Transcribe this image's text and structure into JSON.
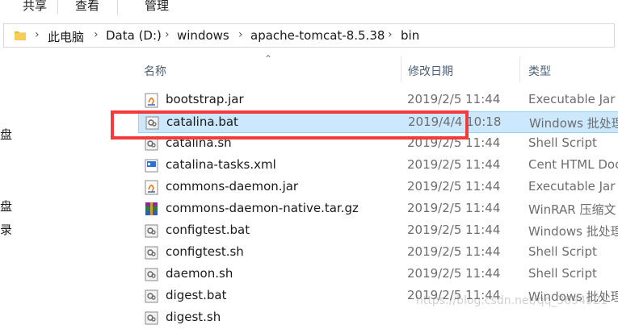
{
  "ribbon": {
    "tabs": [
      "共享",
      "查看",
      "管理"
    ]
  },
  "address_bar": {
    "breadcrumbs": [
      "此电脑",
      "Data (D:)",
      "windows",
      "apache-tomcat-8.5.38",
      "bin"
    ]
  },
  "nav_pane": {
    "partial_items": [
      "盘",
      "盘",
      "录"
    ]
  },
  "columns": {
    "name": "名称",
    "date": "修改日期",
    "type": "类型"
  },
  "files": [
    {
      "name": "bootstrap.jar",
      "date": "2019/2/5 11:44",
      "type": "Executable Jar F",
      "icon": "jar-icon"
    },
    {
      "name": "catalina.bat",
      "date": "2019/4/4 10:18",
      "type": "Windows 批处理",
      "icon": "bat-icon",
      "selected": true
    },
    {
      "name": "catalina.sh",
      "date": "2019/2/5 11:44",
      "type": "Shell Script",
      "icon": "sh-icon"
    },
    {
      "name": "catalina-tasks.xml",
      "date": "2019/2/5 11:44",
      "type": "Cent HTML Doc",
      "icon": "xml-icon"
    },
    {
      "name": "commons-daemon.jar",
      "date": "2019/2/5 11:44",
      "type": "Executable Jar F",
      "icon": "jar-icon"
    },
    {
      "name": "commons-daemon-native.tar.gz",
      "date": "2019/2/5 11:44",
      "type": "WinRAR 压缩文",
      "icon": "winrar-icon"
    },
    {
      "name": "configtest.bat",
      "date": "2019/2/5 11:44",
      "type": "Windows 批处理",
      "icon": "bat-icon"
    },
    {
      "name": "configtest.sh",
      "date": "2019/2/5 11:44",
      "type": "Shell Script",
      "icon": "sh-icon"
    },
    {
      "name": "daemon.sh",
      "date": "2019/2/5 11:44",
      "type": "Shell Script",
      "icon": "sh-icon"
    },
    {
      "name": "digest.bat",
      "date": "2019/2/5 11:44",
      "type": "Windows 批处理",
      "icon": "bat-icon"
    },
    {
      "name": "digest.sh",
      "date": "",
      "type": "",
      "icon": "sh-icon"
    }
  ],
  "watermark": "https://blog.csdn.net/qq_3694921",
  "colors": {
    "selection_bg": "#cce8ff",
    "annotation_red": "#f23c3c",
    "header_text": "#4c607a"
  }
}
